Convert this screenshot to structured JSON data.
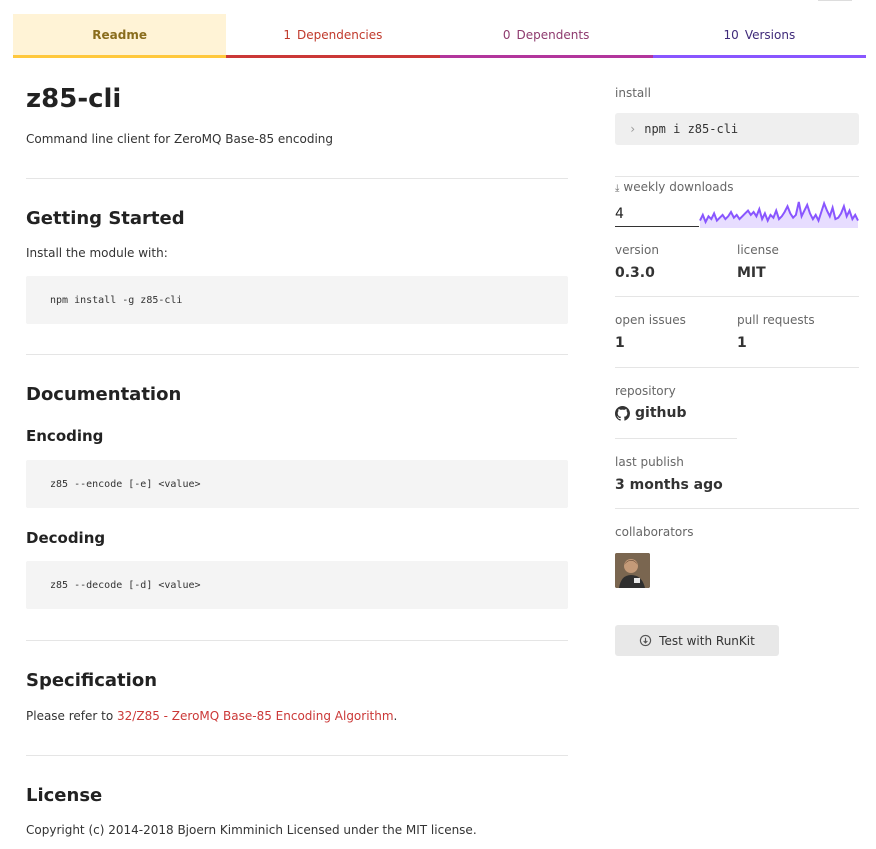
{
  "tabs": [
    {
      "count": "",
      "label": "Readme"
    },
    {
      "count": "1",
      "label": "Dependencies"
    },
    {
      "count": "0",
      "label": "Dependents"
    },
    {
      "count": "10",
      "label": "Versions"
    }
  ],
  "package": {
    "name": "z85-cli",
    "description": "Command line client for ZeroMQ Base-85 encoding"
  },
  "readme": {
    "getting_started": {
      "heading": "Getting Started",
      "text": "Install the module with:",
      "code": "npm install -g z85-cli"
    },
    "documentation": {
      "heading": "Documentation",
      "encoding_heading": "Encoding",
      "encoding_code": "z85 --encode [-e] <value>",
      "decoding_heading": "Decoding",
      "decoding_code": "z85 --decode [-d] <value>"
    },
    "specification": {
      "heading": "Specification",
      "text_before": "Please refer to ",
      "link_text": "32/Z85 - ZeroMQ Base-85 Encoding Algorithm",
      "text_after": "."
    },
    "license": {
      "heading": "License",
      "text": "Copyright (c) 2014-2018 Bjoern Kimminich Licensed under the MIT license."
    }
  },
  "sidebar": {
    "install_label": "install",
    "install_cmd": "npm i z85-cli",
    "weekly_downloads_label": "weekly downloads",
    "weekly_downloads_value": "4",
    "sparkline": [
      2,
      6,
      1,
      5,
      3,
      7,
      2,
      4,
      6,
      3,
      5,
      8,
      4,
      6,
      3,
      5,
      7,
      9,
      6,
      8,
      5,
      10,
      3,
      7,
      2,
      6,
      4,
      9,
      3,
      5,
      8,
      12,
      7,
      4,
      6,
      15,
      5,
      9,
      13,
      7,
      3,
      6,
      2,
      8,
      14,
      9,
      5,
      11,
      3,
      4,
      7,
      12,
      5,
      9,
      3,
      6,
      2
    ],
    "version_label": "version",
    "version_value": "0.3.0",
    "license_label": "license",
    "license_value": "MIT",
    "open_issues_label": "open issues",
    "open_issues_value": "1",
    "pull_requests_label": "pull requests",
    "pull_requests_value": "1",
    "repository_label": "repository",
    "repository_value": "github",
    "last_publish_label": "last publish",
    "last_publish_value": "3 months ago",
    "collaborators_label": "collaborators",
    "runkit_label": "Test with RunKit"
  },
  "colors": {
    "readme": "#ffc83d",
    "dependencies": "#cb3837",
    "dependents": "#b2359c",
    "versions": "#8956ff",
    "sparkline": "#8956ff"
  }
}
